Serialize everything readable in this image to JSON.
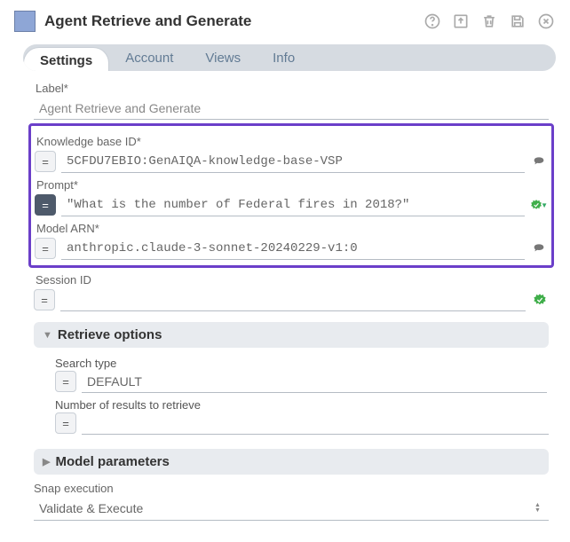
{
  "header": {
    "title": "Agent Retrieve and Generate"
  },
  "tabs": {
    "settings": "Settings",
    "account": "Account",
    "views": "Views",
    "info": "Info"
  },
  "fields": {
    "label": {
      "label": "Label*",
      "value": "Agent Retrieve and Generate"
    },
    "kb": {
      "label": "Knowledge base ID*",
      "value": "5CFDU7EBIO:GenAIQA-knowledge-base-VSP"
    },
    "prompt": {
      "label": "Prompt*",
      "value": "\"What is the number of Federal fires in 2018?\""
    },
    "arn": {
      "label": "Model ARN*",
      "value": "anthropic.claude-3-sonnet-20240229-v1:0"
    },
    "session": {
      "label": "Session ID",
      "value": ""
    }
  },
  "sections": {
    "retrieve": {
      "title": "Retrieve options",
      "search_type": {
        "label": "Search type",
        "value": "DEFAULT"
      },
      "num_results": {
        "label": "Number of results to retrieve",
        "value": ""
      }
    },
    "model_params": {
      "title": "Model parameters"
    }
  },
  "snap": {
    "label": "Snap execution",
    "value": "Validate & Execute"
  }
}
